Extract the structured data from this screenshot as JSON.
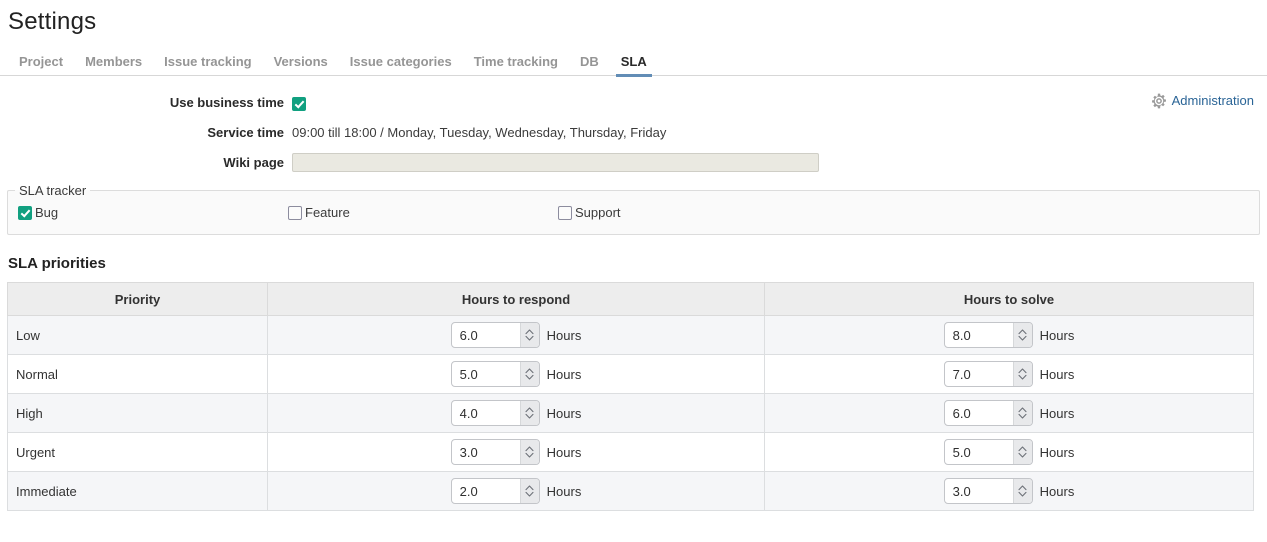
{
  "page": {
    "title": "Settings"
  },
  "tabs": [
    {
      "label": "Project",
      "active": false
    },
    {
      "label": "Members",
      "active": false
    },
    {
      "label": "Issue tracking",
      "active": false
    },
    {
      "label": "Versions",
      "active": false
    },
    {
      "label": "Issue categories",
      "active": false
    },
    {
      "label": "Time tracking",
      "active": false
    },
    {
      "label": "DB",
      "active": false
    },
    {
      "label": "SLA",
      "active": true
    }
  ],
  "form": {
    "business_time": {
      "label": "Use business time",
      "checked": true
    },
    "service_time": {
      "label": "Service time",
      "value": "09:00 till 18:00 / Monday, Tuesday, Wednesday, Thursday, Friday"
    },
    "wiki_page": {
      "label": "Wiki page",
      "value": "",
      "placeholder": ""
    }
  },
  "administration": {
    "label": "Administration",
    "icon": "gear-icon",
    "color": "#2a6496"
  },
  "tracker": {
    "legend": "SLA tracker",
    "items": [
      {
        "label": "Bug",
        "checked": true
      },
      {
        "label": "Feature",
        "checked": false
      },
      {
        "label": "Support",
        "checked": false
      }
    ]
  },
  "priorities": {
    "heading": "SLA priorities",
    "columns": [
      "Priority",
      "Hours to respond",
      "Hours to solve"
    ],
    "unit_label": "Hours",
    "rows": [
      {
        "priority": "Low",
        "respond": "6.0",
        "solve": "8.0"
      },
      {
        "priority": "Normal",
        "respond": "5.0",
        "solve": "7.0"
      },
      {
        "priority": "High",
        "respond": "4.0",
        "solve": "6.0"
      },
      {
        "priority": "Urgent",
        "respond": "3.0",
        "solve": "5.0"
      },
      {
        "priority": "Immediate",
        "respond": "2.0",
        "solve": "3.0"
      }
    ]
  },
  "colors": {
    "accent_tab": "#628db6",
    "checkbox_checked": "#11a080",
    "link": "#2a6496"
  }
}
